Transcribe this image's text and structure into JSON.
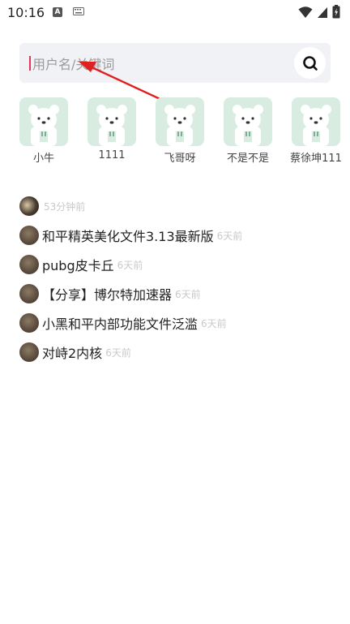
{
  "status_bar": {
    "time": "10:16",
    "notification_a": "A"
  },
  "search": {
    "placeholder": "用户名/关键词",
    "value": ""
  },
  "users": [
    {
      "name": "小牛"
    },
    {
      "name": "1111"
    },
    {
      "name": "飞哥呀"
    },
    {
      "name": "不是不是"
    },
    {
      "name": "蔡徐坤111"
    }
  ],
  "history": [
    {
      "title": "",
      "time": "53分钟前"
    },
    {
      "title": "和平精英美化文件3.13最新版",
      "time": "6天前"
    },
    {
      "title": "pubg皮卡丘",
      "time": "6天前"
    },
    {
      "title": "【分享】博尔特加速器",
      "time": "6天前"
    },
    {
      "title": "小黑和平内部功能文件泛滥",
      "time": "6天前"
    },
    {
      "title": "对峙2内核",
      "time": "6天前"
    }
  ],
  "colors": {
    "accent_caret": "#e8335a",
    "annotation_arrow": "#e02020",
    "avatar_bg": "#d8ece2"
  }
}
